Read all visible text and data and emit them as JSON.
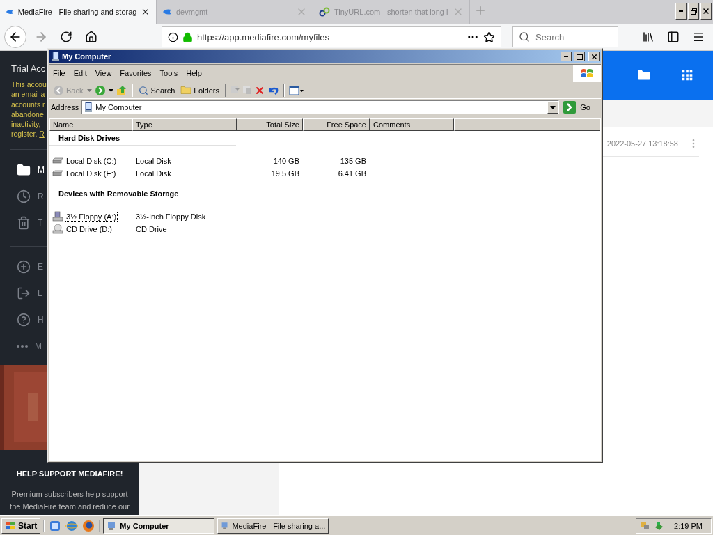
{
  "browser": {
    "tabs": [
      {
        "title": "MediaFire - File sharing and storag",
        "selected": true
      },
      {
        "title": "devmgmt",
        "selected": false
      },
      {
        "title": "TinyURL.com - shorten that long l",
        "selected": false
      }
    ],
    "url": "https://app.mediafire.com/myfiles",
    "search": {
      "placeholder": "Search"
    }
  },
  "page": {
    "sidebar": {
      "account_title": "Trial Acc",
      "notice_lines": [
        "This accou",
        "an email a",
        "accounts r",
        "abandone",
        "inactivity,"
      ],
      "notice_last": {
        "text": "register.",
        "link": "R"
      },
      "nav_primary": [
        {
          "label": "M",
          "selected": true
        },
        {
          "label": "R",
          "selected": false
        },
        {
          "label": "T",
          "selected": false
        }
      ],
      "nav_secondary": [
        {
          "label": "E",
          "selected": false
        },
        {
          "label": "L",
          "selected": false
        },
        {
          "label": "H",
          "selected": false
        },
        {
          "label": "M",
          "selected": false
        }
      ],
      "promo": {
        "kind": "picture"
      },
      "support_title": "HELP SUPPORT MEDIAFIRE!",
      "support_text": "Premium subscribers help support the MediaFire team and reduce our"
    },
    "file_row": {
      "modified": "2022-05-27 13:18:58"
    }
  },
  "window": {
    "title": "My Computer",
    "menu": [
      "File",
      "Edit",
      "View",
      "Favorites",
      "Tools",
      "Help"
    ],
    "toolbar": {
      "back": {
        "label": "Back",
        "disabled": true
      },
      "search": "Search",
      "folders": "Folders"
    },
    "address": {
      "label": "Address",
      "value": "My Computer",
      "go": "Go"
    },
    "columns": [
      "Name",
      "Type",
      "Total Size",
      "Free Space",
      "Comments"
    ],
    "groups": [
      {
        "title": "Hard Disk Drives",
        "items": [
          {
            "name": "Local Disk (C:)",
            "type": "Local Disk",
            "total_size": "140 GB",
            "free_space": "135 GB",
            "kind": "disk",
            "selected": false
          },
          {
            "name": "Local Disk (E:)",
            "type": "Local Disk",
            "total_size": "19.5 GB",
            "free_space": "6.41 GB",
            "kind": "disk",
            "selected": false
          }
        ]
      },
      {
        "title": "Devices with Removable Storage",
        "items": [
          {
            "name": "3½ Floppy (A:)",
            "type": "3½-Inch Floppy Disk",
            "kind": "floppy",
            "selected": true
          },
          {
            "name": "CD Drive (D:)",
            "type": "CD Drive",
            "kind": "cd",
            "selected": false
          }
        ]
      }
    ]
  },
  "taskbar": {
    "start": "Start",
    "tasks": [
      {
        "title": "My Computer",
        "selected": true
      },
      {
        "title": "MediaFire - File sharing a...",
        "selected": false
      }
    ],
    "clock": "2:19 PM"
  }
}
